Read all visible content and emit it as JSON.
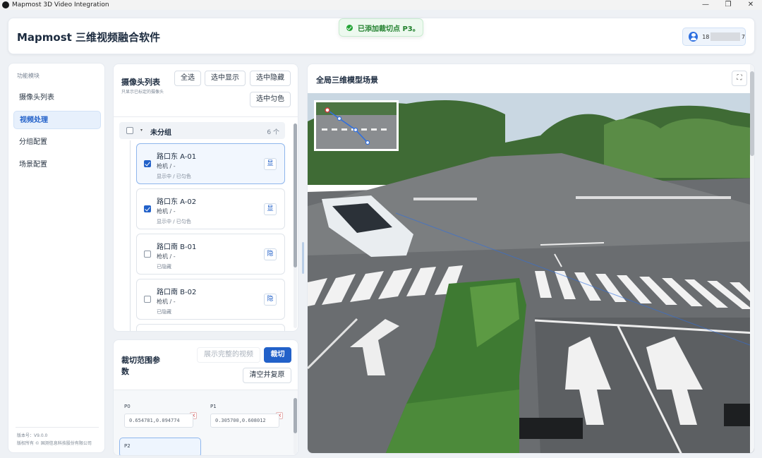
{
  "window": {
    "title": "Mapmost 3D Video Integration",
    "controls": {
      "minimize": "—",
      "restore": "❐",
      "close": "✕"
    }
  },
  "header": {
    "app_name": "Mapmost 三维视频融合软件",
    "user": {
      "prefix": "18",
      "suffix": "7"
    }
  },
  "toast": {
    "text": "已添加裁切点 P3。",
    "color": "#23a436"
  },
  "sidebar": {
    "title": "功能模块",
    "items": [
      {
        "label": "摄像头列表",
        "active": false
      },
      {
        "label": "视频处理",
        "active": true
      },
      {
        "label": "分组配置",
        "active": false
      },
      {
        "label": "场景配置",
        "active": false
      }
    ],
    "version": "版本号：V9.0.0",
    "copyright": "版权所有 © 国测信息科技股份有限公司"
  },
  "camera_panel": {
    "title": "摄像头列表",
    "subtitle": "只显示已标定的摄像头",
    "buttons": {
      "select_all": "全选",
      "show_selected": "选中显示",
      "hide_selected": "选中隐藏",
      "even_color_selected": "选中匀色"
    },
    "group": {
      "name": "未分组",
      "count": "6 个",
      "checked": false
    },
    "cameras": [
      {
        "name": "路口东 A-01",
        "type": "枪机 / -",
        "status": "显示中 / 已匀色",
        "checked": true,
        "toggle": "显",
        "selected": true
      },
      {
        "name": "路口东 A-02",
        "type": "枪机 / -",
        "status": "显示中 / 已匀色",
        "checked": true,
        "toggle": "显",
        "selected": false
      },
      {
        "name": "路口南 B-01",
        "type": "枪机 / -",
        "status": "已隐藏",
        "checked": false,
        "toggle": "隐",
        "selected": false
      },
      {
        "name": "路口南 B-02",
        "type": "枪机 / -",
        "status": "已隐藏",
        "checked": false,
        "toggle": "隐",
        "selected": false
      }
    ]
  },
  "crop_panel": {
    "title": "裁切范围参数",
    "buttons": {
      "show_full_video": "展示完整的视频",
      "crop": "裁切",
      "clear_restore": "清空并复原"
    },
    "points": [
      {
        "label": "P0",
        "value": "0.654781,0.094774"
      },
      {
        "label": "P1",
        "value": "0.305700,0.608012"
      },
      {
        "label": "P2",
        "value": ""
      }
    ],
    "remove_glyph": "×"
  },
  "scene_panel": {
    "title": "全局三维模型场景",
    "fullscreen_icon": "⛶"
  },
  "colors": {
    "accent": "#2261c9",
    "success": "#23a436",
    "danger": "#d23b3b"
  }
}
